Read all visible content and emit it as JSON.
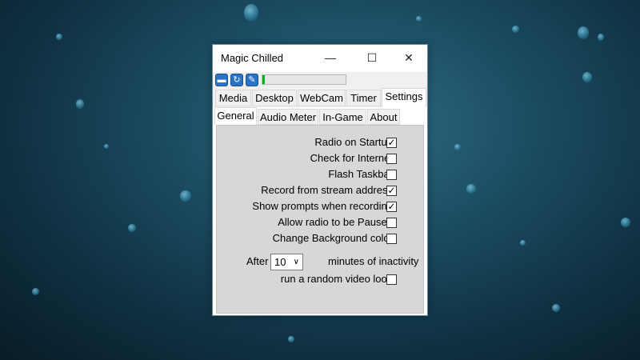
{
  "window": {
    "title": "Magic Chilled",
    "controls": {
      "minimize": "—",
      "maximize": "☐",
      "close": "✕"
    }
  },
  "toolbar": {
    "icons": [
      "folder-icon",
      "refresh-icon",
      "wrench-icon"
    ],
    "progress_fraction": 0.03
  },
  "tabs_top": [
    "Media",
    "Desktop",
    "WebCam",
    "Timer",
    "Settings"
  ],
  "tabs_top_active": "Settings",
  "tabs_sub": [
    "General",
    "Audio Meter",
    "In-Game",
    "About"
  ],
  "tabs_sub_active": "General",
  "options": [
    {
      "label": "Radio on Startup",
      "checked": true
    },
    {
      "label": "Check for Internet",
      "checked": false
    },
    {
      "label": "Flash Taskbar",
      "checked": false
    },
    {
      "label": "Record from stream address",
      "checked": true
    },
    {
      "label": "Show prompts when recording",
      "checked": true
    },
    {
      "label": "Allow radio to be Paused",
      "checked": false
    },
    {
      "label": "Change Background color",
      "checked": false
    }
  ],
  "inactivity": {
    "prefix": "After",
    "minutes_value": "10",
    "suffix": "minutes of inactivity",
    "loop_label": "run a random video loop",
    "loop_checked": false
  },
  "colors": {
    "progress_fill": "#06b025",
    "panel_bg": "#d7d7d7"
  }
}
